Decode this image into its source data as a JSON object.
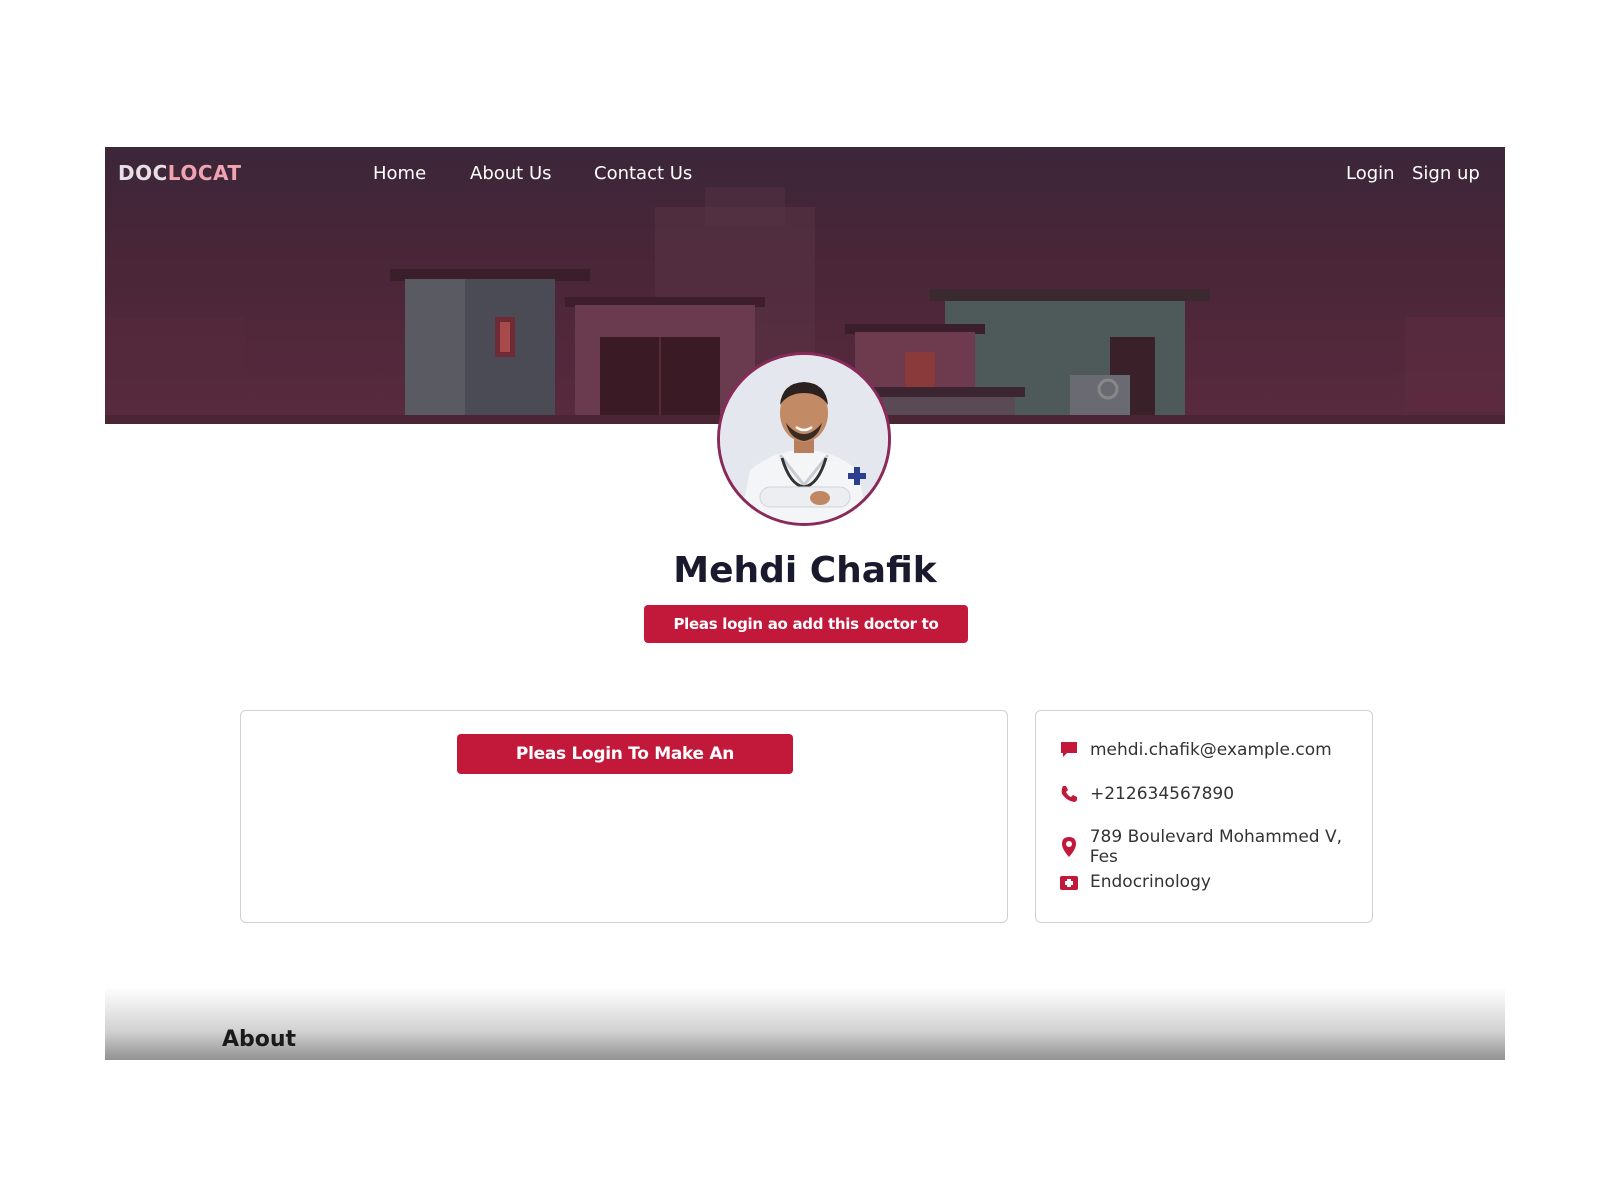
{
  "brand": {
    "part1": "DOC",
    "part2": "LOCAT"
  },
  "nav": {
    "home": "Home",
    "about": "About Us",
    "contact": "Contact Us",
    "login": "Login",
    "signup": "Sign up"
  },
  "doctor": {
    "name": "Mehdi Chafik",
    "favorites_button": "Pleas login ao add this doctor to favorites",
    "appointment_button": "Pleas Login To Make An Appointment",
    "email": "mehdi.chafik@example.com",
    "phone": "+212634567890",
    "address": "789 Boulevard Mohammed V, Fes",
    "specialty": "Endocrinology"
  },
  "sections": {
    "about_title": "About"
  },
  "colors": {
    "accent": "#c2183a",
    "hero": "#4a2638"
  },
  "icons": [
    "message-icon",
    "phone-icon",
    "location-pin-icon",
    "medical-kit-icon"
  ]
}
